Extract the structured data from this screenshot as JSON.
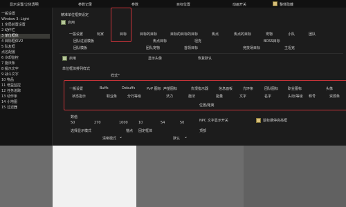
{
  "topbar": {
    "items": [
      "显示设置/立体透明",
      "参数记录",
      "参数",
      "目标位置",
      "动画开关",
      "整体隐藏"
    ]
  },
  "sidebar": {
    "items": [
      "一般设置",
      "Window 3: Light",
      "1 全局前置设置",
      "2 动作栏",
      "3 单位框体",
      "4 目标框体V2",
      "5 队友框",
      "  点名配置",
      "6 冷却监控",
      "7 施法条",
      "8 提示文字",
      "9 战斗文字",
      "10 物品",
      "11 增益监控",
      "12 任务追踪",
      "13 动作条",
      "14 小地图",
      "15 过滤器"
    ],
    "selected_index": 4
  },
  "main": {
    "section_title": "精准单位框架设定",
    "enable_label": "启用",
    "tabs_row1": [
      "一般设置",
      "玩家",
      "目标",
      "目标的目标",
      "目标的目标的目标",
      "焦点",
      "焦点的目标",
      "宠物",
      "小队",
      "团队"
    ],
    "tabs_row2": [
      "团队过滤模板",
      "焦点目标",
      "首领",
      "竞技场",
      "坦克",
      "BOSS目标"
    ],
    "tabs_row3": [
      "团队模板",
      "团队宠物",
      "首领目标",
      "竞技场目标",
      "主坦克",
      "助理"
    ],
    "opt_enable": "启用",
    "opt_show_portrait": "显示头像",
    "opt_default": "恢复默认",
    "layout_title": "单位框体排列样式",
    "dropdown_label": "样式",
    "grid_row1": [
      "一般设置",
      "Buffs",
      "Debuffs",
      "PvP 图标",
      "声望图标",
      "仇恨指示器",
      "信息面板",
      "光环条",
      "团队图标",
      "职业图标",
      "头像"
    ],
    "grid_row2": [
      "状态指示",
      "职业条",
      "分行等级",
      "法力",
      "施法",
      "能量",
      "文字",
      "名字",
      "头衔/等级",
      "称号",
      "资源条"
    ],
    "position_label": "位置/距离",
    "values_label": "数值",
    "values": [
      "50",
      "270",
      "1000",
      "10",
      "54",
      "50"
    ],
    "npc_toggle": "NPC 文字显示开关",
    "hover_highlight": "鼠标悬停高亮框",
    "select_label": "选择显示模式",
    "select_value": "清晰模式",
    "point_label": "锚点",
    "point_value": "顶部",
    "fix_label": "固定框体",
    "fix_value": "默认"
  }
}
